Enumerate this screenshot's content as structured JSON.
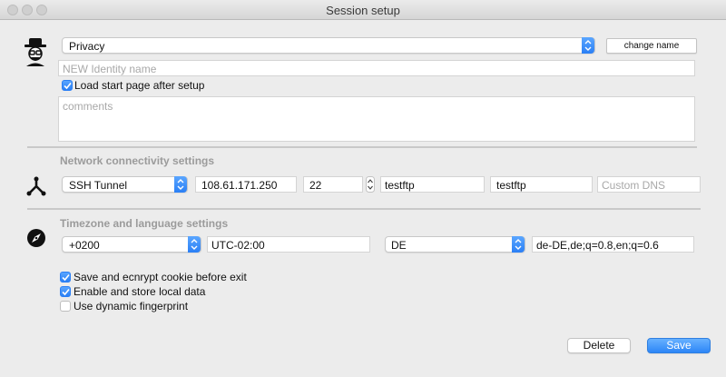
{
  "window": {
    "title": "Session setup"
  },
  "identity": {
    "profile_select": "Privacy",
    "change_name_label": "change name",
    "name_placeholder": "NEW Identity name",
    "load_start_page_label": "Load start page after setup",
    "load_start_page_checked": true,
    "comments_placeholder": "comments",
    "icon": "spy-incognito-icon"
  },
  "network": {
    "section_title": "Network connectivity settings",
    "icon": "network-branch-icon",
    "connection_type": "SSH Tunnel",
    "host": "108.61.171.250",
    "port": "22",
    "username": "testftp",
    "password": "testftp",
    "dns_placeholder": "Custom DNS"
  },
  "timezone": {
    "section_title": "Timezone and language settings",
    "icon": "compass-icon",
    "offset_select": "+0200",
    "timezone_value": "UTC-02:00",
    "language_select": "DE",
    "accept_language": "de-DE,de;q=0.8,en;q=0.6"
  },
  "options": [
    {
      "label": "Save and ecnrypt cookie before exit",
      "checked": true
    },
    {
      "label": "Enable and store local data",
      "checked": true
    },
    {
      "label": "Use dynamic fingerprint",
      "checked": false
    }
  ],
  "footer": {
    "delete_label": "Delete",
    "save_label": "Save"
  },
  "colors": {
    "accent": "#2a7ff5",
    "window_bg": "#ececec"
  }
}
